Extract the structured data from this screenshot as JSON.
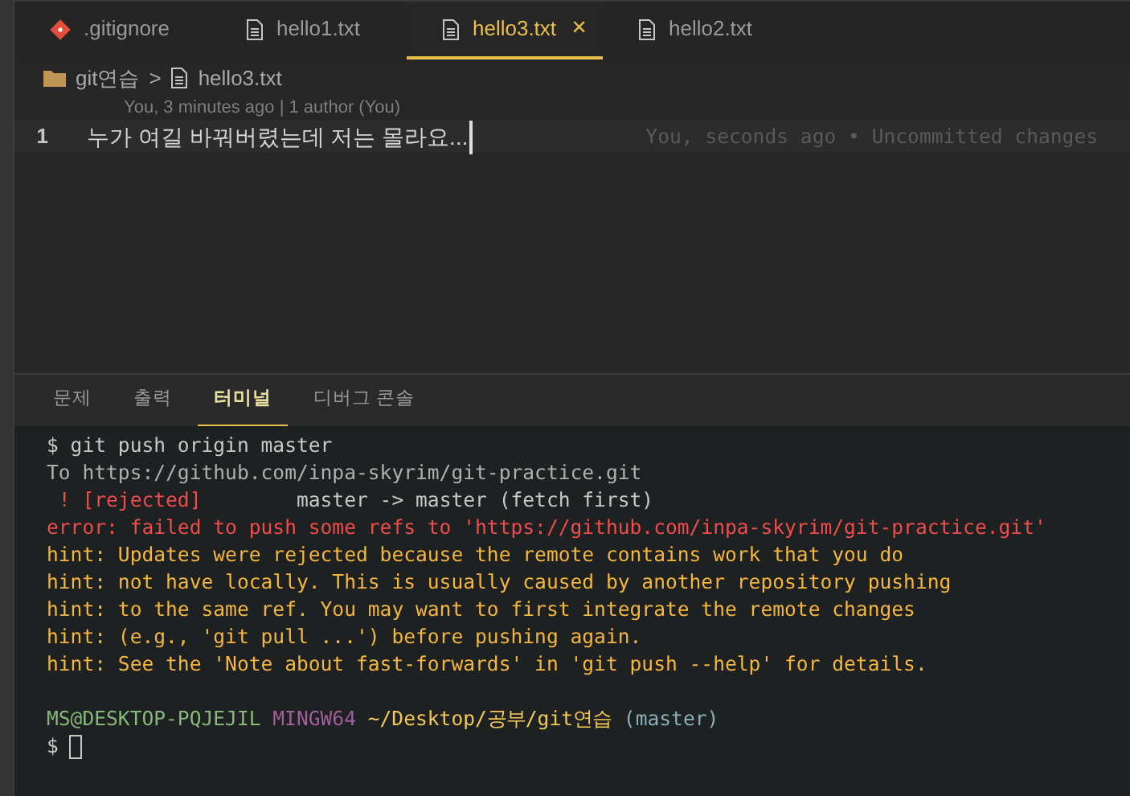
{
  "tabs": [
    {
      "label": ".gitignore",
      "kind": "git",
      "selected": false
    },
    {
      "label": "hello1.txt",
      "kind": "file",
      "selected": false
    },
    {
      "label": "hello3.txt",
      "kind": "file",
      "selected": true,
      "close": "×"
    },
    {
      "label": "hello2.txt",
      "kind": "file",
      "selected": false
    }
  ],
  "breadcrumb": {
    "items": [
      {
        "label": "git연습",
        "kind": "folder"
      },
      {
        "label": "hello3.txt",
        "kind": "file"
      }
    ],
    "separator": ">"
  },
  "editor": {
    "blame_header": "You, 3 minutes ago | 1 author (You)",
    "lines": [
      {
        "number": "1",
        "text": "누가 여길 바꿔버렸는데 저는 몰라요...",
        "annotation": "You, seconds ago • Uncommitted changes"
      }
    ]
  },
  "panel_tabs": [
    {
      "label": "문제",
      "selected": false
    },
    {
      "label": "출력",
      "selected": false
    },
    {
      "label": "터미널",
      "selected": true
    },
    {
      "label": "디버그 콘솔",
      "selected": false
    }
  ],
  "terminal": {
    "output": [
      [
        {
          "text": "$ git push origin master",
          "kind": "plain"
        }
      ],
      [
        {
          "text": "To https://github.com/inpa-skyrim/git-practice.git",
          "kind": "dim"
        }
      ],
      [
        {
          "text": " ! [rejected]",
          "kind": "error"
        },
        {
          "text": "        master -> master (fetch first)",
          "kind": "plain"
        }
      ],
      [
        {
          "text": "error: failed to push some refs to 'https://github.com/inpa-skyrim/git-practice.git'",
          "kind": "error"
        }
      ],
      [
        {
          "text": "hint: Updates were rejected because the remote contains work that you do",
          "kind": "hint"
        }
      ],
      [
        {
          "text": "hint: not have locally. This is usually caused by another repository pushing",
          "kind": "hint"
        }
      ],
      [
        {
          "text": "hint: to the same ref. You may want to first integrate the remote changes",
          "kind": "hint"
        }
      ],
      [
        {
          "text": "hint: (e.g., 'git pull ...') before pushing again.",
          "kind": "hint"
        }
      ],
      [
        {
          "text": "hint: See the 'Note about fast-forwards' in 'git push --help' for details.",
          "kind": "hint"
        }
      ]
    ],
    "prompt": [
      {
        "text": "MS@DESKTOP-PQJEJIL",
        "kind": "user"
      },
      {
        "text": "MINGW64",
        "kind": "host"
      },
      {
        "text": "~/Desktop/공부/git연습",
        "kind": "path"
      },
      {
        "text": "(master)",
        "kind": "branch"
      }
    ],
    "input": {
      "prompt": "$"
    }
  }
}
